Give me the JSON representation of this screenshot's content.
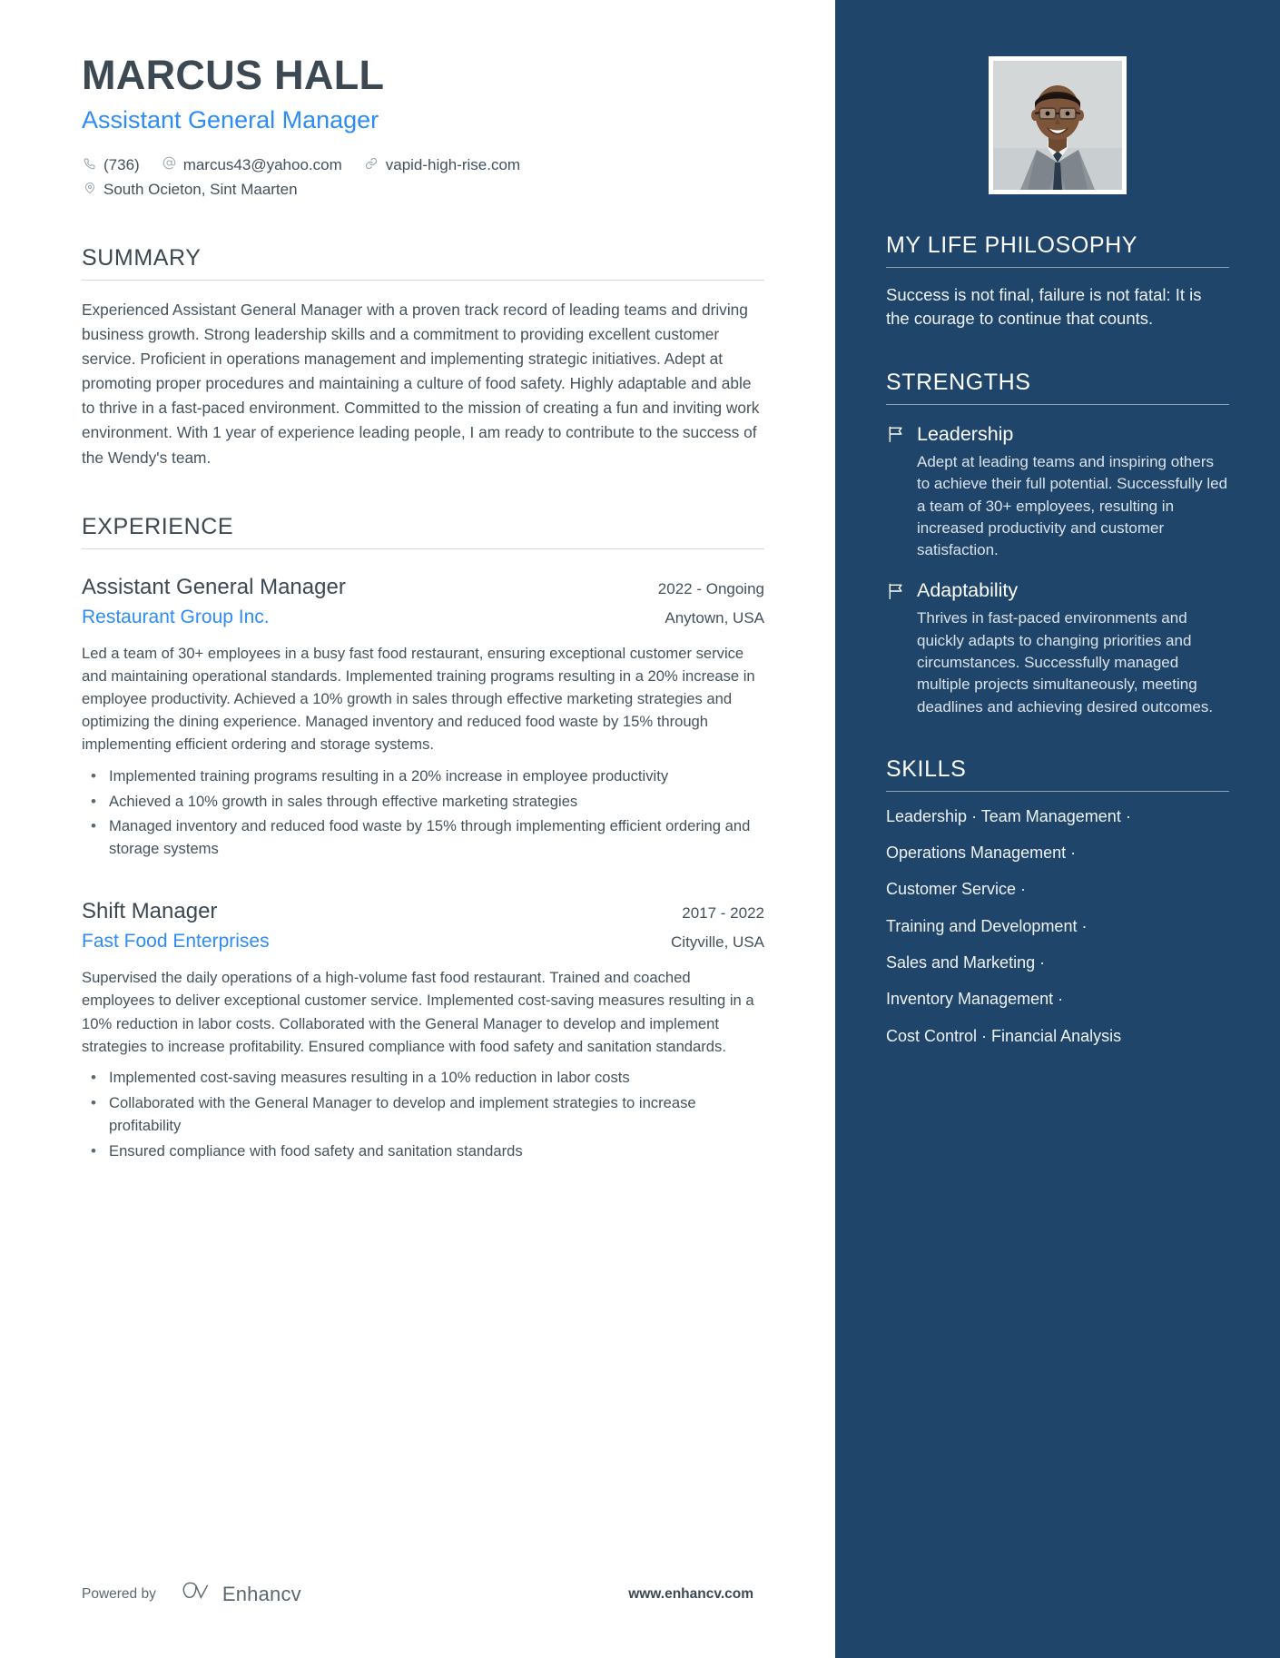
{
  "header": {
    "name": "MARCUS HALL",
    "role": "Assistant General Manager",
    "phone": "(736)",
    "email": "marcus43@yahoo.com",
    "website": "vapid-high-rise.com",
    "location": "South Ocieton, Sint Maarten",
    "phone_icon": "phone-icon",
    "email_icon": "at-icon",
    "website_icon": "link-icon",
    "location_icon": "map-pin-icon"
  },
  "summary": {
    "title": "SUMMARY",
    "text": "Experienced Assistant General Manager with a proven track record of leading teams and driving business growth. Strong leadership skills and a commitment to providing excellent customer service. Proficient in operations management and implementing strategic initiatives. Adept at promoting proper procedures and maintaining a culture of food safety. Highly adaptable and able to thrive in a fast-paced environment. Committed to the mission of creating a fun and inviting work environment. With 1 year of experience leading people, I am ready to contribute to the success of the Wendy's team."
  },
  "experience": {
    "title": "EXPERIENCE",
    "jobs": [
      {
        "title": "Assistant General Manager",
        "dates": "2022 - Ongoing",
        "company": "Restaurant Group Inc.",
        "location": "Anytown, USA",
        "description": "Led a team of 30+ employees in a busy fast food restaurant, ensuring exceptional customer service and maintaining operational standards. Implemented training programs resulting in a 20% increase in employee productivity. Achieved a 10% growth in sales through effective marketing strategies and optimizing the dining experience. Managed inventory and reduced food waste by 15% through implementing efficient ordering and storage systems.",
        "bullets": [
          "Implemented training programs resulting in a 20% increase in employee productivity",
          "Achieved a 10% growth in sales through effective marketing strategies",
          "Managed inventory and reduced food waste by 15% through implementing efficient ordering and storage systems"
        ]
      },
      {
        "title": "Shift Manager",
        "dates": "2017 - 2022",
        "company": "Fast Food Enterprises",
        "location": "Cityville, USA",
        "description": "Supervised the daily operations of a high-volume fast food restaurant. Trained and coached employees to deliver exceptional customer service. Implemented cost-saving measures resulting in a 10% reduction in labor costs. Collaborated with the General Manager to develop and implement strategies to increase profitability. Ensured compliance with food safety and sanitation standards.",
        "bullets": [
          "Implemented cost-saving measures resulting in a 10% reduction in labor costs",
          "Collaborated with the General Manager to develop and implement strategies to increase profitability",
          "Ensured compliance with food safety and sanitation standards"
        ]
      }
    ]
  },
  "sidebar": {
    "philosophy": {
      "title": "MY LIFE PHILOSOPHY",
      "text": "Success is not final, failure is not fatal: It is the courage to continue that counts."
    },
    "strengths": {
      "title": "STRENGTHS",
      "items": [
        {
          "icon": "flag-icon",
          "name": "Leadership",
          "description": "Adept at leading teams and inspiring others to achieve their full potential. Successfully led a team of 30+ employees, resulting in increased productivity and customer satisfaction."
        },
        {
          "icon": "flag-icon",
          "name": "Adaptability",
          "description": "Thrives in fast-paced environments and quickly adapts to changing priorities and circumstances. Successfully managed multiple projects simultaneously, meeting deadlines and achieving desired outcomes."
        }
      ]
    },
    "skills": {
      "title": "SKILLS",
      "lines": [
        "Leadership · Team Management ·",
        "Operations Management ·",
        "Customer Service ·",
        "Training and Development ·",
        "Sales and Marketing ·",
        "Inventory Management ·",
        "Cost Control · Financial Analysis"
      ]
    }
  },
  "footer": {
    "powered_by": "Powered by",
    "brand": "Enhancv",
    "url": "www.enhancv.com"
  },
  "colors": {
    "sidebar_bg": "#20456a",
    "accent_blue": "#2d8cf5",
    "heading_dark": "#3c4852"
  }
}
